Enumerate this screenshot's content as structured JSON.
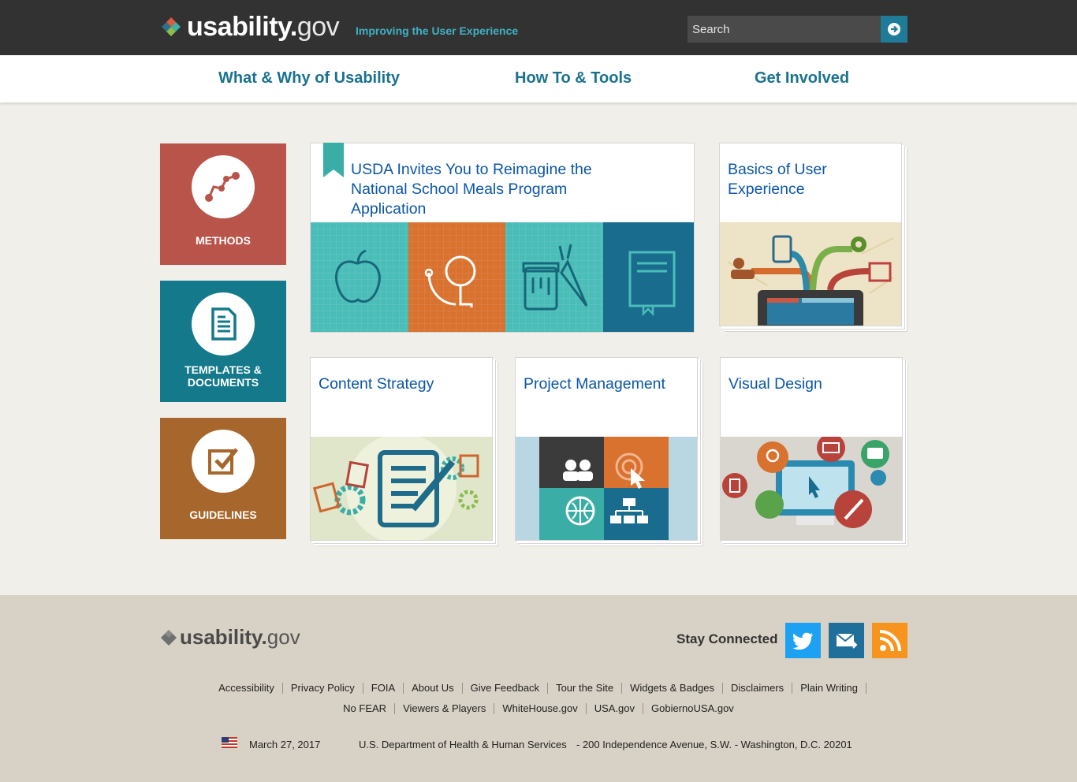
{
  "header": {
    "logo_main": "usability.",
    "logo_gov": "gov",
    "tagline": "Improving the User Experience",
    "search_placeholder": "Search"
  },
  "nav": [
    {
      "label": "What & Why of Usability"
    },
    {
      "label": "How To & Tools"
    },
    {
      "label": "Get Involved"
    }
  ],
  "side_tiles": [
    {
      "label": "METHODS",
      "color": "#b9544a",
      "icon": "methods-graph-icon"
    },
    {
      "label": "TEMPLATES & DOCUMENTS",
      "color": "#14798b",
      "icon": "document-icon"
    },
    {
      "label": "GUIDELINES",
      "color": "#a7662b",
      "icon": "checkbox-icon"
    }
  ],
  "cards": {
    "featured": {
      "title": "USDA Invites You to Reimagine the National School Meals Program Application"
    },
    "basics": {
      "title": "Basics of User Experience"
    },
    "content": {
      "title": "Content Strategy"
    },
    "project": {
      "title": "Project Management"
    },
    "visual": {
      "title": "Visual Design"
    }
  },
  "footer": {
    "logo_main": "usability.",
    "logo_gov": "gov",
    "stay_connected": "Stay Connected",
    "social": [
      "twitter-icon",
      "email-icon",
      "rss-icon"
    ],
    "links_row1": [
      "Accessibility",
      "Privacy Policy",
      "FOIA",
      "About Us",
      "Give Feedback",
      "Tour the Site",
      "Widgets & Badges",
      "Disclaimers",
      "Plain Writing"
    ],
    "links_row2": [
      "No FEAR",
      "Viewers & Players",
      "WhiteHouse.gov",
      "USA.gov",
      "GobiernoUSA.gov"
    ],
    "date": "March 27, 2017",
    "department": "U.S. Department of Health & Human Services",
    "address": "- 200 Independence Avenue, S.W. - Washington, D.C. 20201"
  }
}
